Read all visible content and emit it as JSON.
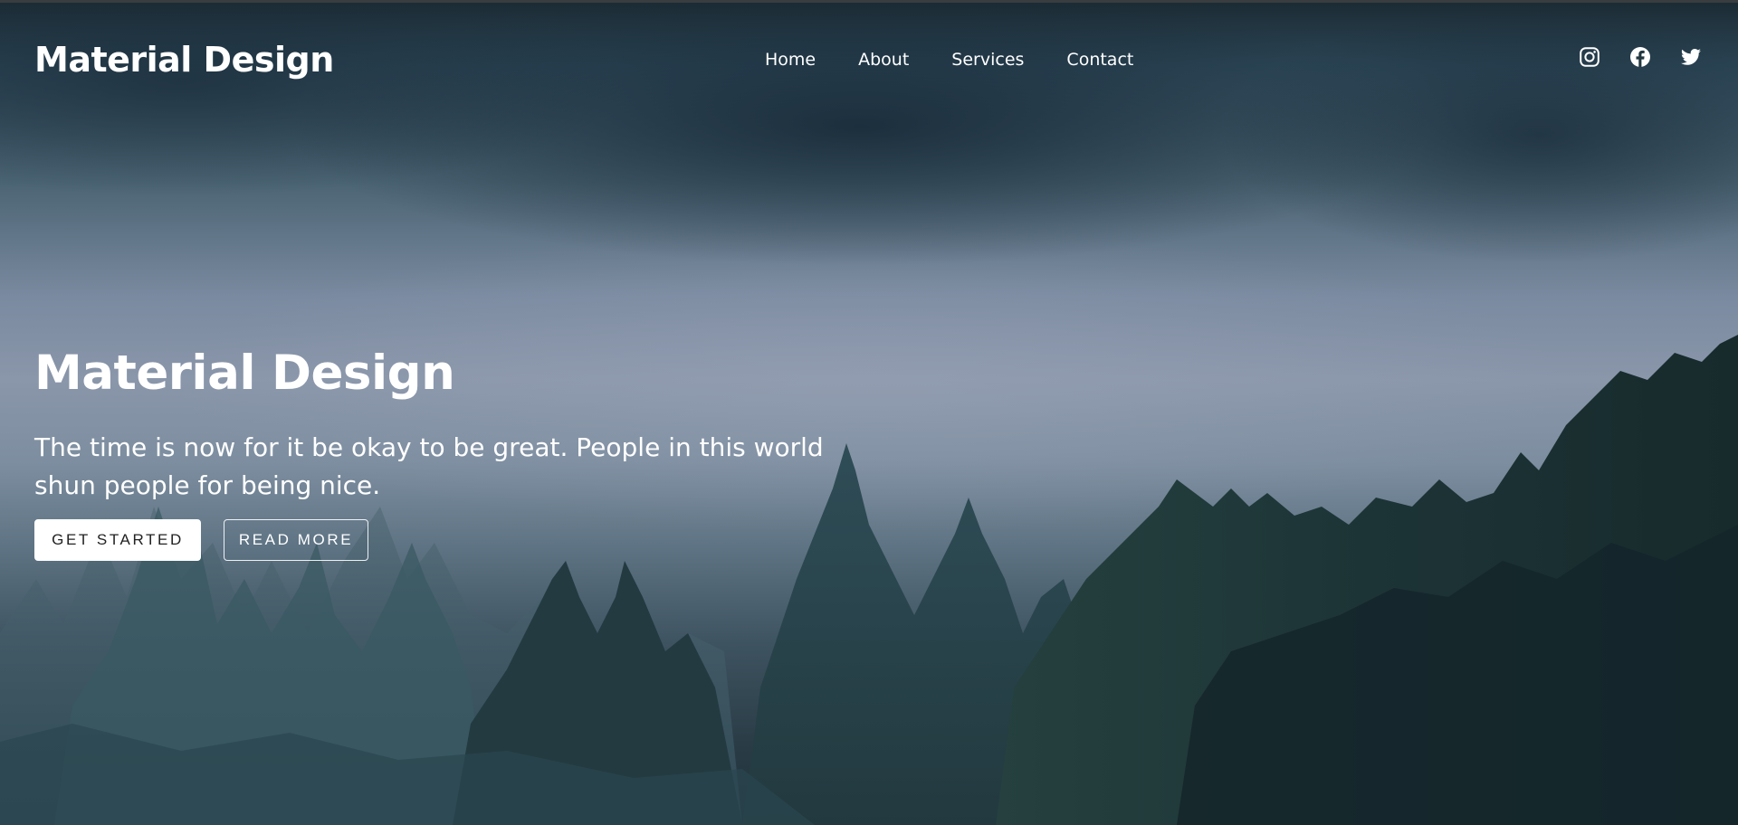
{
  "navbar": {
    "brand": "Material Design",
    "links": [
      {
        "label": "Home"
      },
      {
        "label": "About"
      },
      {
        "label": "Services"
      },
      {
        "label": "Contact"
      }
    ],
    "social_icons": [
      "instagram-icon",
      "facebook-icon",
      "twitter-icon"
    ]
  },
  "hero": {
    "title": "Material Design",
    "subtitle": "The time is now for it be okay to be great. People in this world shun people for being nice.",
    "primary_button": "GET STARTED",
    "secondary_button": "READ MORE",
    "background": "misty pine forest under cloudy sky"
  },
  "colors": {
    "text": "#ffffff",
    "primary_button_bg": "#ffffff",
    "primary_button_text": "#222222",
    "sky_dark": "#1b2a33",
    "sky_mist": "#8a96aa",
    "forest_dark": "#1a2c2e"
  }
}
